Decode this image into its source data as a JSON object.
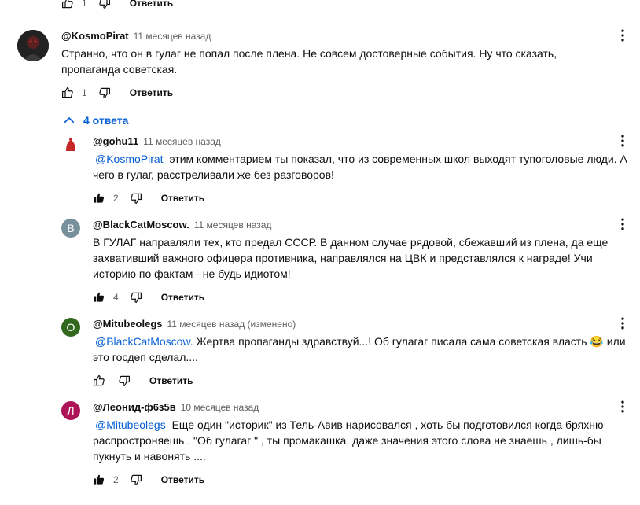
{
  "top_partial": {
    "likes": "1",
    "reply_label": "Ответить"
  },
  "comment": {
    "author": "@KosmoPirat",
    "time": "11 месяцев назад",
    "text": "Странно, что он в гулаг не попал после плена. Не совсем достоверные события. Ну что сказать, пропаганда советская.",
    "likes": "1",
    "reply_label": "Ответить",
    "replies_toggle": "4 ответа"
  },
  "replies": [
    {
      "author": "@gohu11",
      "time": "11 месяцев назад",
      "avatar_letter": "",
      "avatar_color": "#ffffff",
      "mention": "@KosmoPirat",
      "text": " этим комментарием ты показал, что из современных школ выходят тупоголовые люди. А чего в гулаг, расстреливали же без разговоров!",
      "likes": "2",
      "liked": true,
      "reply_label": "Ответить"
    },
    {
      "author": "@BlackCatMoscow.",
      "time": "11 месяцев назад",
      "avatar_letter": "B",
      "avatar_color": "#78909c",
      "mention": "",
      "text": "В ГУЛАГ направляли тех, кто предал СССР. В данном случае рядовой, сбежавший из плена, да еще захвативший важного офицера противника, направлялся на ЦВК и представлялся к награде! Учи историю по фактам - не будь идиотом!",
      "likes": "4",
      "liked": true,
      "reply_label": "Ответить"
    },
    {
      "author": "@Mitubeolegs",
      "time": "11 месяцев назад (изменено)",
      "avatar_letter": "O",
      "avatar_color": "#33691e",
      "mention": "@BlackCatMoscow.",
      "text": "Жертва пропаганды здравствуй...! Об гулагаг писала сама советская власть 😂 или это госдеп сделал....",
      "likes": "",
      "liked": false,
      "reply_label": "Ответить"
    },
    {
      "author": "@Леонид-ф6з5в",
      "time": "10 месяцев назад",
      "avatar_letter": "Л",
      "avatar_color": "#ad1457",
      "mention": "@Mitubeolegs",
      "text": " Еще один \"историк\" из Тель-Авив нарисовался , хоть бы подготовился когда бряхню распростроняешь . \"Об гулагаг \" , ты промакашка, даже значения этого слова не знаешь , лишь-бы пукнуть и навонять ....",
      "likes": "2",
      "liked": true,
      "reply_label": "Ответить"
    }
  ],
  "icons": {
    "like": "thumbs-up-icon",
    "dislike": "thumbs-down-icon",
    "more": "more-vert-icon",
    "chevron": "chevron-up-icon"
  },
  "colors": {
    "link": "#065fd4",
    "meta": "#606060",
    "text": "#0f0f0f"
  }
}
